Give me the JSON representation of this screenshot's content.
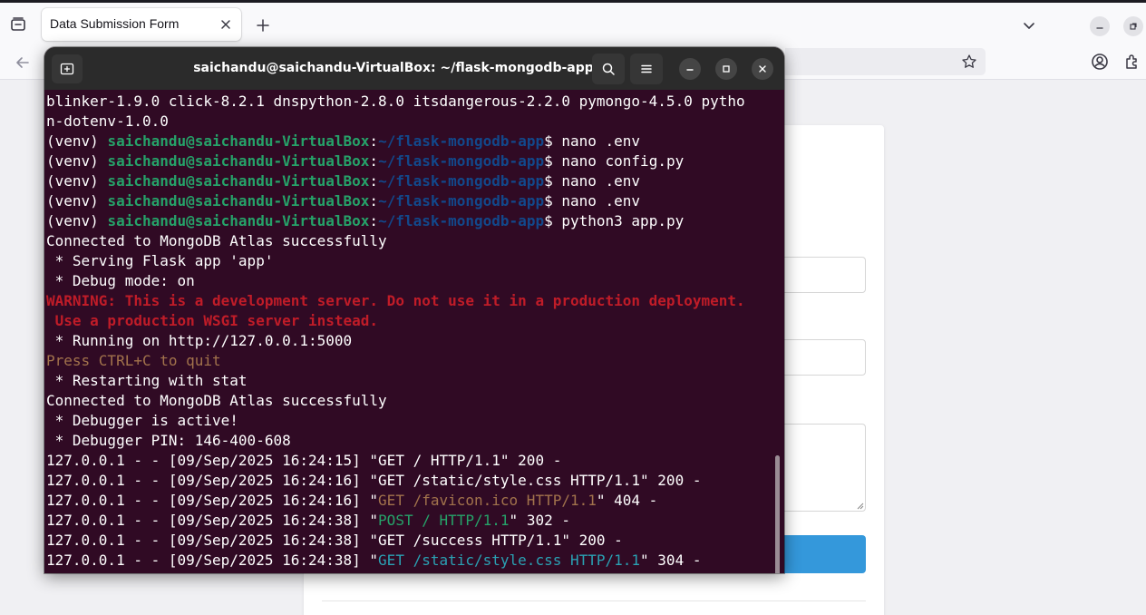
{
  "browser": {
    "tab_title": "Data Submission Form"
  },
  "terminal": {
    "title": "saichandu@saichandu-VirtualBox: ~/flask-mongodb-app",
    "lines": [
      [
        {
          "t": "blinker-1.9.0 click-8.2.1 dnspython-2.8.0 itsdangerous-2.2.0 pymongo-4.5.0 pytho",
          "c": ""
        }
      ],
      [
        {
          "t": "n-dotenv-1.0.0",
          "c": ""
        }
      ],
      [
        {
          "t": "(venv) ",
          "c": ""
        },
        {
          "t": "saichandu@saichandu-VirtualBox",
          "c": "c-user"
        },
        {
          "t": ":",
          "c": ""
        },
        {
          "t": "~/flask-mongodb-app",
          "c": "c-path"
        },
        {
          "t": "$ nano .env",
          "c": ""
        }
      ],
      [
        {
          "t": "(venv) ",
          "c": ""
        },
        {
          "t": "saichandu@saichandu-VirtualBox",
          "c": "c-user"
        },
        {
          "t": ":",
          "c": ""
        },
        {
          "t": "~/flask-mongodb-app",
          "c": "c-path"
        },
        {
          "t": "$ nano config.py",
          "c": ""
        }
      ],
      [
        {
          "t": "(venv) ",
          "c": ""
        },
        {
          "t": "saichandu@saichandu-VirtualBox",
          "c": "c-user"
        },
        {
          "t": ":",
          "c": ""
        },
        {
          "t": "~/flask-mongodb-app",
          "c": "c-path"
        },
        {
          "t": "$ nano .env",
          "c": ""
        }
      ],
      [
        {
          "t": "(venv) ",
          "c": ""
        },
        {
          "t": "saichandu@saichandu-VirtualBox",
          "c": "c-user"
        },
        {
          "t": ":",
          "c": ""
        },
        {
          "t": "~/flask-mongodb-app",
          "c": "c-path"
        },
        {
          "t": "$ nano .env",
          "c": ""
        }
      ],
      [
        {
          "t": "(venv) ",
          "c": ""
        },
        {
          "t": "saichandu@saichandu-VirtualBox",
          "c": "c-user"
        },
        {
          "t": ":",
          "c": ""
        },
        {
          "t": "~/flask-mongodb-app",
          "c": "c-path"
        },
        {
          "t": "$ python3 app.py",
          "c": ""
        }
      ],
      [
        {
          "t": "Connected to MongoDB Atlas successfully",
          "c": ""
        }
      ],
      [
        {
          "t": " * Serving Flask app 'app'",
          "c": ""
        }
      ],
      [
        {
          "t": " * Debug mode: on",
          "c": ""
        }
      ],
      [
        {
          "t": "WARNING: This is a development server. Do not use it in a production deployment.",
          "c": "c-warn"
        }
      ],
      [
        {
          "t": " Use a production WSGI server instead.",
          "c": "c-warn"
        }
      ],
      [
        {
          "t": " * Running on http://127.0.0.1:5000",
          "c": ""
        }
      ],
      [
        {
          "t": "Press CTRL+C to quit",
          "c": "c-quit"
        }
      ],
      [
        {
          "t": " * Restarting with stat",
          "c": ""
        }
      ],
      [
        {
          "t": "Connected to MongoDB Atlas successfully",
          "c": ""
        }
      ],
      [
        {
          "t": " * Debugger is active!",
          "c": ""
        }
      ],
      [
        {
          "t": " * Debugger PIN: 146-400-608",
          "c": ""
        }
      ],
      [
        {
          "t": "127.0.0.1 - - [09/Sep/2025 16:24:15] \"GET / HTTP/1.1\" 200 -",
          "c": ""
        }
      ],
      [
        {
          "t": "127.0.0.1 - - [09/Sep/2025 16:24:16] \"GET /static/style.css HTTP/1.1\" 200 -",
          "c": ""
        }
      ],
      [
        {
          "t": "127.0.0.1 - - [09/Sep/2025 16:24:16] \"",
          "c": ""
        },
        {
          "t": "GET /favicon.ico HTTP/1.1",
          "c": "c-ylw"
        },
        {
          "t": "\" 404 -",
          "c": ""
        }
      ],
      [
        {
          "t": "127.0.0.1 - - [09/Sep/2025 16:24:38] \"",
          "c": ""
        },
        {
          "t": "POST / HTTP/1.1",
          "c": "c-grn"
        },
        {
          "t": "\" 302 -",
          "c": ""
        }
      ],
      [
        {
          "t": "127.0.0.1 - - [09/Sep/2025 16:24:38] \"GET /success HTTP/1.1\" 200 -",
          "c": ""
        }
      ],
      [
        {
          "t": "127.0.0.1 - - [09/Sep/2025 16:24:38] \"",
          "c": ""
        },
        {
          "t": "GET /static/style.css HTTP/1.1",
          "c": "c-cyn"
        },
        {
          "t": "\" 304 -",
          "c": ""
        }
      ]
    ]
  },
  "colors": {
    "terminal_bg": "#300a24",
    "prompt_user": "#26a269",
    "prompt_path": "#12488b",
    "warning": "#c01c28",
    "submit_button": "#3498db"
  },
  "icons": [
    "tab-overview-icon",
    "close-icon",
    "plus-icon",
    "chevron-down-icon",
    "minimize-icon",
    "restore-icon",
    "back-arrow-icon",
    "star-icon",
    "account-icon",
    "extensions-icon",
    "new-tab-icon",
    "search-icon",
    "hamburger-menu-icon",
    "maximize-icon"
  ]
}
